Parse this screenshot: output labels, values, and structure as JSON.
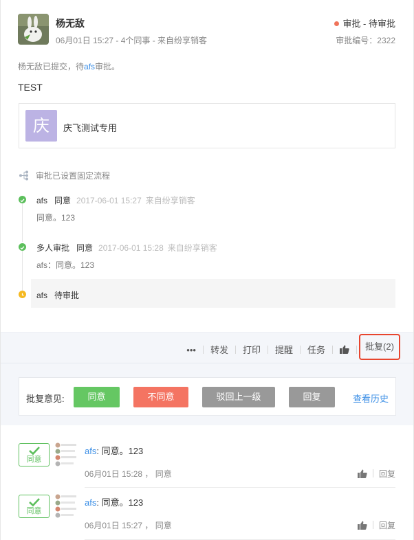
{
  "header": {
    "user_name": "杨无敌",
    "meta": "06月01日 15:27 - 4个同事 - 来自纷享销客",
    "status": "审批 - 待审批",
    "status_color": "#f0735a",
    "serial": "审批编号：2322"
  },
  "submit_note": {
    "prefix": "杨无敌已提交，待",
    "approver": "afs",
    "suffix": "审批。"
  },
  "content_title": "TEST",
  "attachment": {
    "icon_char": "庆",
    "name": "庆飞测试专用"
  },
  "flow": {
    "heading": "审批已设置固定流程",
    "nodes": [
      {
        "who": "afs",
        "action": "同意",
        "time": "2017-06-01 15:27",
        "source": "来自纷享销客",
        "comment": "同意。123"
      },
      {
        "who": "多人审批",
        "action": "同意",
        "time": "2017-06-01 15:28",
        "source": "来自纷享销客",
        "comment": "afs：同意。123"
      }
    ],
    "pending": {
      "who": "afs",
      "status": "待审批"
    }
  },
  "toolbar": {
    "more": "•••",
    "forward": "转发",
    "print": "打印",
    "remind": "提醒",
    "task": "任务",
    "reply": "批复(2)"
  },
  "reply_panel": {
    "label": "批复意见:",
    "agree": "同意",
    "disagree": "不同意",
    "reject_prev": "驳回上一级",
    "reply": "回复",
    "history": "查看历史"
  },
  "replies": [
    {
      "stamp": "同意",
      "who": "afs",
      "text": ": 同意。123",
      "time": "06月01日 15:28 ， 同意",
      "reply_label": "回复"
    },
    {
      "stamp": "同意",
      "who": "afs",
      "text": ": 同意。123",
      "time": "06月01日 15:27 ， 同意",
      "reply_label": "回复"
    }
  ],
  "colors": {
    "accent_link": "#3a8ee6",
    "agree_green": "#65c763",
    "disagree_red": "#f47462",
    "pending_yellow": "#f5b921",
    "highlight_border": "#e8452e"
  }
}
